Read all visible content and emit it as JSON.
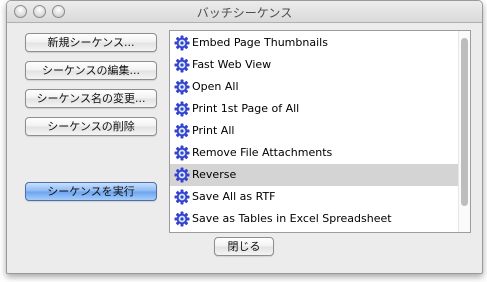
{
  "window": {
    "title": "バッチシーケンス"
  },
  "sidebar": {
    "new_sequence": "新規シーケンス...",
    "edit_sequence": "シーケンスの編集...",
    "rename_sequence": "シーケンス名の変更...",
    "delete_sequence": "シーケンスの削除",
    "run_sequence": "シーケンスを実行"
  },
  "list": {
    "items": [
      {
        "label": "Embed Page Thumbnails",
        "selected": false
      },
      {
        "label": "Fast Web View",
        "selected": false
      },
      {
        "label": "Open All",
        "selected": false
      },
      {
        "label": "Print 1st Page of All",
        "selected": false
      },
      {
        "label": "Print All",
        "selected": false
      },
      {
        "label": "Remove File Attachments",
        "selected": false
      },
      {
        "label": "Reverse",
        "selected": true
      },
      {
        "label": "Save All as RTF",
        "selected": false
      },
      {
        "label": "Save as Tables in Excel Spreadsheet",
        "selected": false
      }
    ],
    "item_icon": "gear-icon"
  },
  "footer": {
    "close": "閉じる"
  },
  "colors": {
    "window_bg": "#ececec",
    "selection": "#d4d4d4",
    "default_button": "#6aa3ee",
    "icon_blue": "#3344cc"
  }
}
